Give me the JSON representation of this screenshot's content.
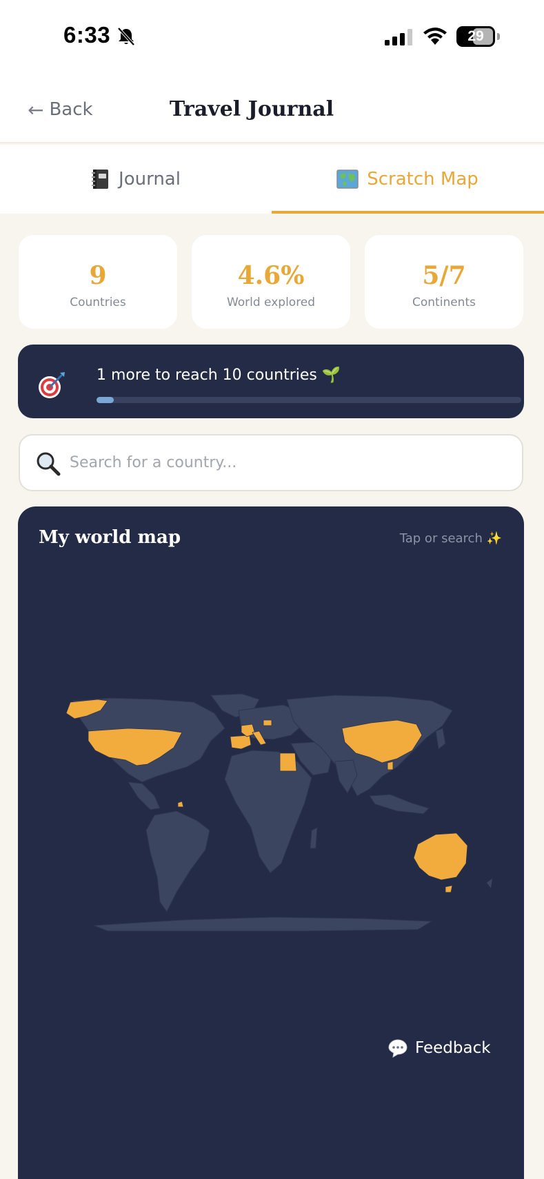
{
  "status_bar": {
    "time": "6:33",
    "battery": "29"
  },
  "header": {
    "back_label": "Back",
    "title": "Travel Journal"
  },
  "tabs": [
    {
      "label": "Journal",
      "icon": "notebook-icon",
      "active": false
    },
    {
      "label": "Scratch Map",
      "icon": "world-map-icon",
      "active": true
    }
  ],
  "stats": [
    {
      "value": "9",
      "label": "Countries"
    },
    {
      "value": "4.6%",
      "label": "World explored"
    },
    {
      "value": "5/7",
      "label": "Continents"
    }
  ],
  "goal": {
    "text": "1 more to reach 10 countries 🌱",
    "progress": 0.04
  },
  "search": {
    "placeholder": "Search for a country..."
  },
  "map": {
    "title": "My world map",
    "hint": "Tap or search ✨",
    "visited_color": "#f2ac3d",
    "land_color": "#3c4560",
    "background": "#232b47"
  },
  "feedback": {
    "label": "Feedback"
  },
  "colors": {
    "accent": "#e8a838",
    "navy": "#232b47",
    "page_bg": "#f8f5ef"
  }
}
